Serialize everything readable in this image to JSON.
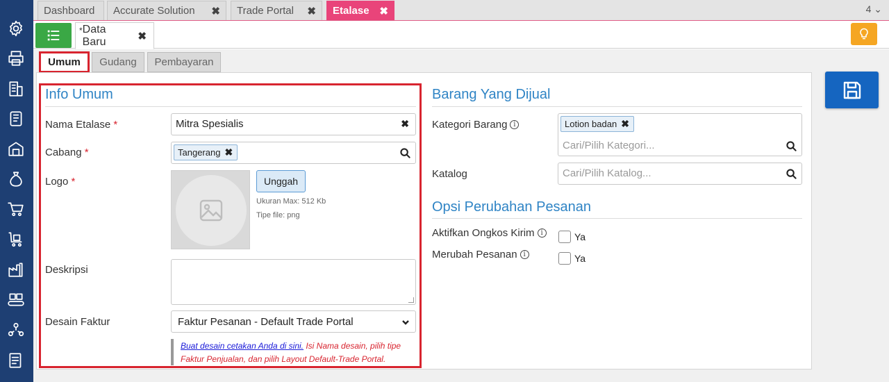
{
  "top_tabs": [
    {
      "label": "Dashboard",
      "closable": false,
      "active": false
    },
    {
      "label": "Accurate Solution",
      "closable": true,
      "active": false
    },
    {
      "label": "Trade Portal",
      "closable": true,
      "active": false
    },
    {
      "label": "Etalase",
      "closable": true,
      "active": true
    }
  ],
  "tab_count": "4",
  "close_glyph": "✖",
  "chevron_glyph": "⌄",
  "doc_tab": {
    "modified_mark": "*",
    "label": "Data Baru"
  },
  "sub_tabs": [
    {
      "label": "Umum",
      "active": true
    },
    {
      "label": "Gudang",
      "active": false
    },
    {
      "label": "Pembayaran",
      "active": false
    }
  ],
  "info_umum": {
    "title": "Info Umum",
    "nama_etalase": {
      "label": "Nama Etalase",
      "required_mark": "*",
      "value": "Mitra Spesialis"
    },
    "cabang": {
      "label": "Cabang",
      "required_mark": "*",
      "chip": "Tangerang"
    },
    "logo": {
      "label": "Logo",
      "required_mark": "*",
      "upload_label": "Unggah",
      "max_size": "Ukuran Max: 512 Kb",
      "file_type": "Tipe file: png"
    },
    "deskripsi": {
      "label": "Deskripsi",
      "value": ""
    },
    "desain_faktur": {
      "label": "Desain Faktur",
      "selected": "Faktur Pesanan - Default Trade Portal"
    },
    "note": {
      "link": "Buat desain cetakan Anda di sini.",
      "text": " Isi Nama desain, pilih tipe Faktur Penjualan, dan pilih Layout Default-Trade Portal."
    }
  },
  "barang": {
    "title": "Barang Yang Dijual",
    "kategori": {
      "label": "Kategori Barang",
      "chip": "Lotion badan",
      "placeholder": "Cari/Pilih Kategori..."
    },
    "katalog": {
      "label": "Katalog",
      "placeholder": "Cari/Pilih Katalog..."
    }
  },
  "opsi": {
    "title": "Opsi Perubahan Pesanan",
    "ongkos_kirim": {
      "label": "Aktifkan Ongkos Kirim",
      "option": "Ya",
      "checked": false
    },
    "merubah_pesanan": {
      "label": "Merubah Pesanan",
      "option": "Ya",
      "checked": false
    }
  },
  "info_glyph": "i",
  "sidebar_icons": [
    "gear-icon",
    "printer-icon",
    "building-icon",
    "notebook-icon",
    "warehouse-icon",
    "money-bag-icon",
    "cart-icon",
    "cart-box-icon",
    "factory-icon",
    "conveyor-icon",
    "share-people-icon",
    "tax-document-icon"
  ],
  "colors": {
    "sidebar": "#1e3f73",
    "active_tab": "#e9447a",
    "accent_blue": "#2f84c5",
    "highlight_red": "#d8242f",
    "save_button": "#1565c0",
    "list_button": "#3aa845",
    "bulb_button": "#f5a623"
  }
}
